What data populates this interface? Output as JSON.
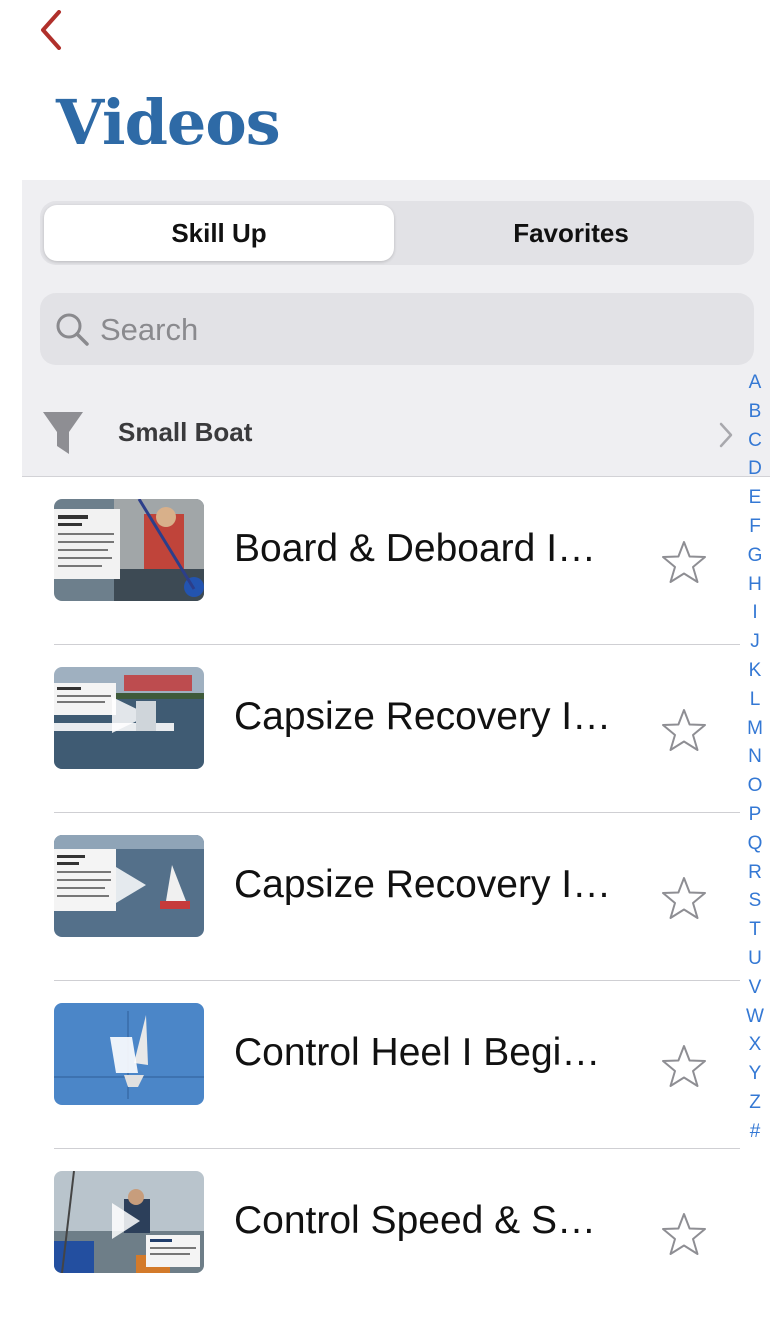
{
  "nav": {
    "back_icon": "chevron-left-icon",
    "title": "Videos"
  },
  "tabs": [
    {
      "label": "Skill Up",
      "selected": true
    },
    {
      "label": "Favorites",
      "selected": false
    }
  ],
  "search": {
    "placeholder": "Search",
    "value": ""
  },
  "filter": {
    "label": "Small Boat",
    "icon": "funnel-icon"
  },
  "videos": [
    {
      "title": "Board & Deboard I…",
      "favorite": false
    },
    {
      "title": "Capsize Recovery I…",
      "favorite": false
    },
    {
      "title": "Capsize Recovery I…",
      "favorite": false
    },
    {
      "title": "Control Heel I Begi…",
      "favorite": false
    },
    {
      "title": "Control Speed & S…",
      "favorite": false
    }
  ],
  "index_letters": [
    "A",
    "B",
    "C",
    "D",
    "E",
    "F",
    "G",
    "H",
    "I",
    "J",
    "K",
    "L",
    "M",
    "N",
    "O",
    "P",
    "Q",
    "R",
    "S",
    "T",
    "U",
    "V",
    "W",
    "X",
    "Y",
    "Z",
    "#"
  ],
  "colors": {
    "accent": "#2e6aa6",
    "back": "#b0302b",
    "index": "#3478d4",
    "star": "#8e8e93"
  }
}
